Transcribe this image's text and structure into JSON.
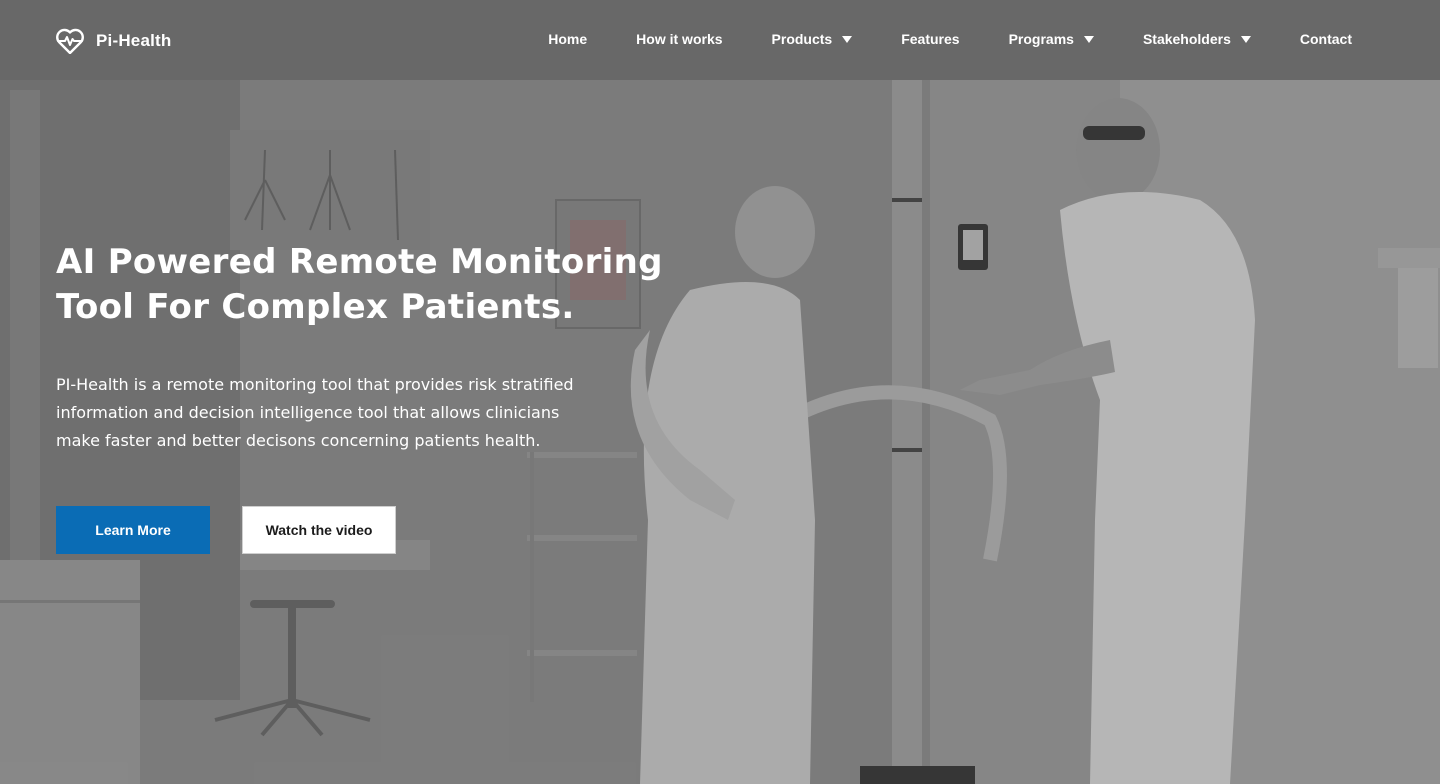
{
  "brand": {
    "name": "Pi-Health",
    "icon": "heart-pulse-icon"
  },
  "nav": {
    "items": [
      {
        "label": "Home",
        "dropdown": false
      },
      {
        "label": "How it works",
        "dropdown": false
      },
      {
        "label": "Products",
        "dropdown": true
      },
      {
        "label": "Features",
        "dropdown": false
      },
      {
        "label": "Programs",
        "dropdown": true
      },
      {
        "label": "Stakeholders",
        "dropdown": true
      },
      {
        "label": "Contact",
        "dropdown": false
      }
    ]
  },
  "hero": {
    "title_line1": "AI Powered Remote Monitoring",
    "title_line2": "Tool For Complex Patients.",
    "description_line1": "PI-Health is a remote monitoring tool that provides risk stratified",
    "description_line2": "information and decision intelligence tool that allows clinicians",
    "description_line3": "make faster and better decisons concerning patients health.",
    "primary_button": "Learn More",
    "secondary_button": "Watch the video"
  },
  "colors": {
    "primary_button": "#0a6cb5",
    "secondary_button_bg": "#ffffff",
    "text": "#ffffff"
  }
}
